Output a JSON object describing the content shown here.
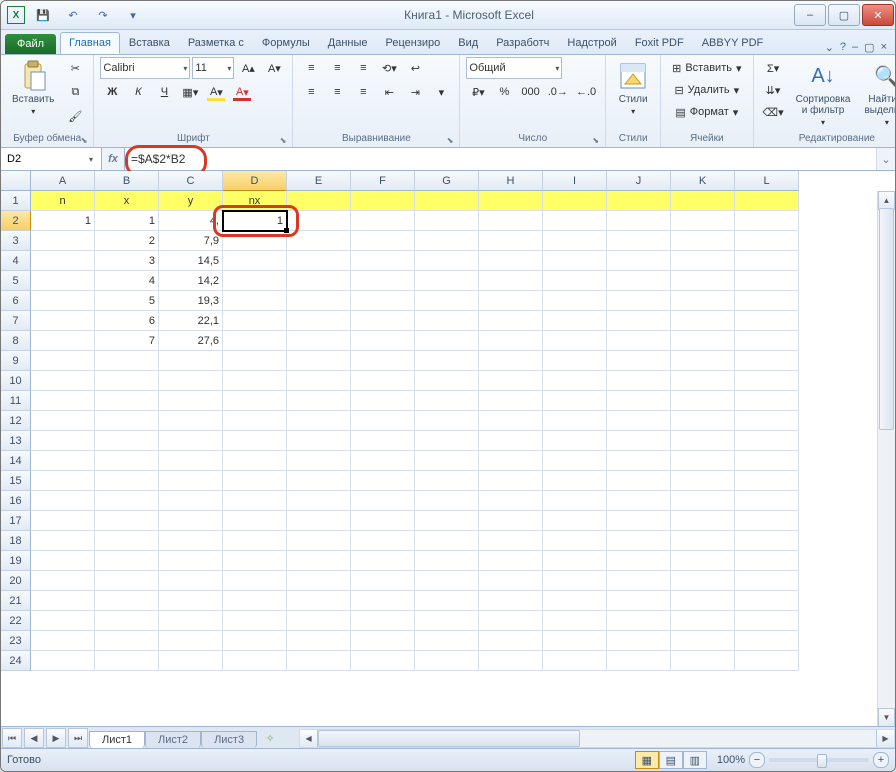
{
  "title": "Книга1 - Microsoft Excel",
  "qat": {
    "save": "💾",
    "undo": "↶",
    "redo": "↷"
  },
  "tabs": {
    "file": "Файл",
    "list": [
      "Главная",
      "Вставка",
      "Разметка с",
      "Формулы",
      "Данные",
      "Рецензиро",
      "Вид",
      "Разработч",
      "Надстрой",
      "Foxit PDF",
      "ABBYY PDF"
    ],
    "active": 0
  },
  "ribbon": {
    "clipboard": {
      "paste": "Вставить",
      "label": "Буфер обмена"
    },
    "font": {
      "name": "Calibri",
      "size": "11",
      "label": "Шрифт",
      "bold": "Ж",
      "italic": "К",
      "underline": "Ч"
    },
    "align": {
      "label": "Выравнивание"
    },
    "number": {
      "format": "Общий",
      "label": "Число"
    },
    "styles": {
      "label": "Стили",
      "btn": "Стили"
    },
    "cells": {
      "insert": "Вставить",
      "delete": "Удалить",
      "format": "Формат",
      "label": "Ячейки"
    },
    "editing": {
      "sort": "Сортировка\nи фильтр",
      "find": "Найти и\nвыделить",
      "label": "Редактирование"
    }
  },
  "namebox": "D2",
  "formula": "=$A$2*B2",
  "columns": [
    "A",
    "B",
    "C",
    "D",
    "E",
    "F",
    "G",
    "H",
    "I",
    "J",
    "K",
    "L"
  ],
  "sel": {
    "col": 3,
    "row": 1
  },
  "rows": [
    {
      "hdr": true,
      "c": [
        "n",
        "x",
        "y",
        "nx",
        "",
        "",
        "",
        "",
        "",
        "",
        "",
        ""
      ]
    },
    {
      "c": [
        "1",
        "1",
        "4,",
        "1",
        "",
        "",
        "",
        "",
        "",
        "",
        "",
        ""
      ]
    },
    {
      "c": [
        "",
        "2",
        "7,9",
        "",
        "",
        "",
        "",
        "",
        "",
        "",
        "",
        ""
      ]
    },
    {
      "c": [
        "",
        "3",
        "14,5",
        "",
        "",
        "",
        "",
        "",
        "",
        "",
        "",
        ""
      ]
    },
    {
      "c": [
        "",
        "4",
        "14,2",
        "",
        "",
        "",
        "",
        "",
        "",
        "",
        "",
        ""
      ]
    },
    {
      "c": [
        "",
        "5",
        "19,3",
        "",
        "",
        "",
        "",
        "",
        "",
        "",
        "",
        ""
      ]
    },
    {
      "c": [
        "",
        "6",
        "22,1",
        "",
        "",
        "",
        "",
        "",
        "",
        "",
        "",
        ""
      ]
    },
    {
      "c": [
        "",
        "7",
        "27,6",
        "",
        "",
        "",
        "",
        "",
        "",
        "",
        "",
        ""
      ]
    }
  ],
  "totalRows": 24,
  "sheets": {
    "list": [
      "Лист1",
      "Лист2",
      "Лист3"
    ],
    "active": 0
  },
  "status": {
    "ready": "Готово",
    "zoom": "100%"
  }
}
